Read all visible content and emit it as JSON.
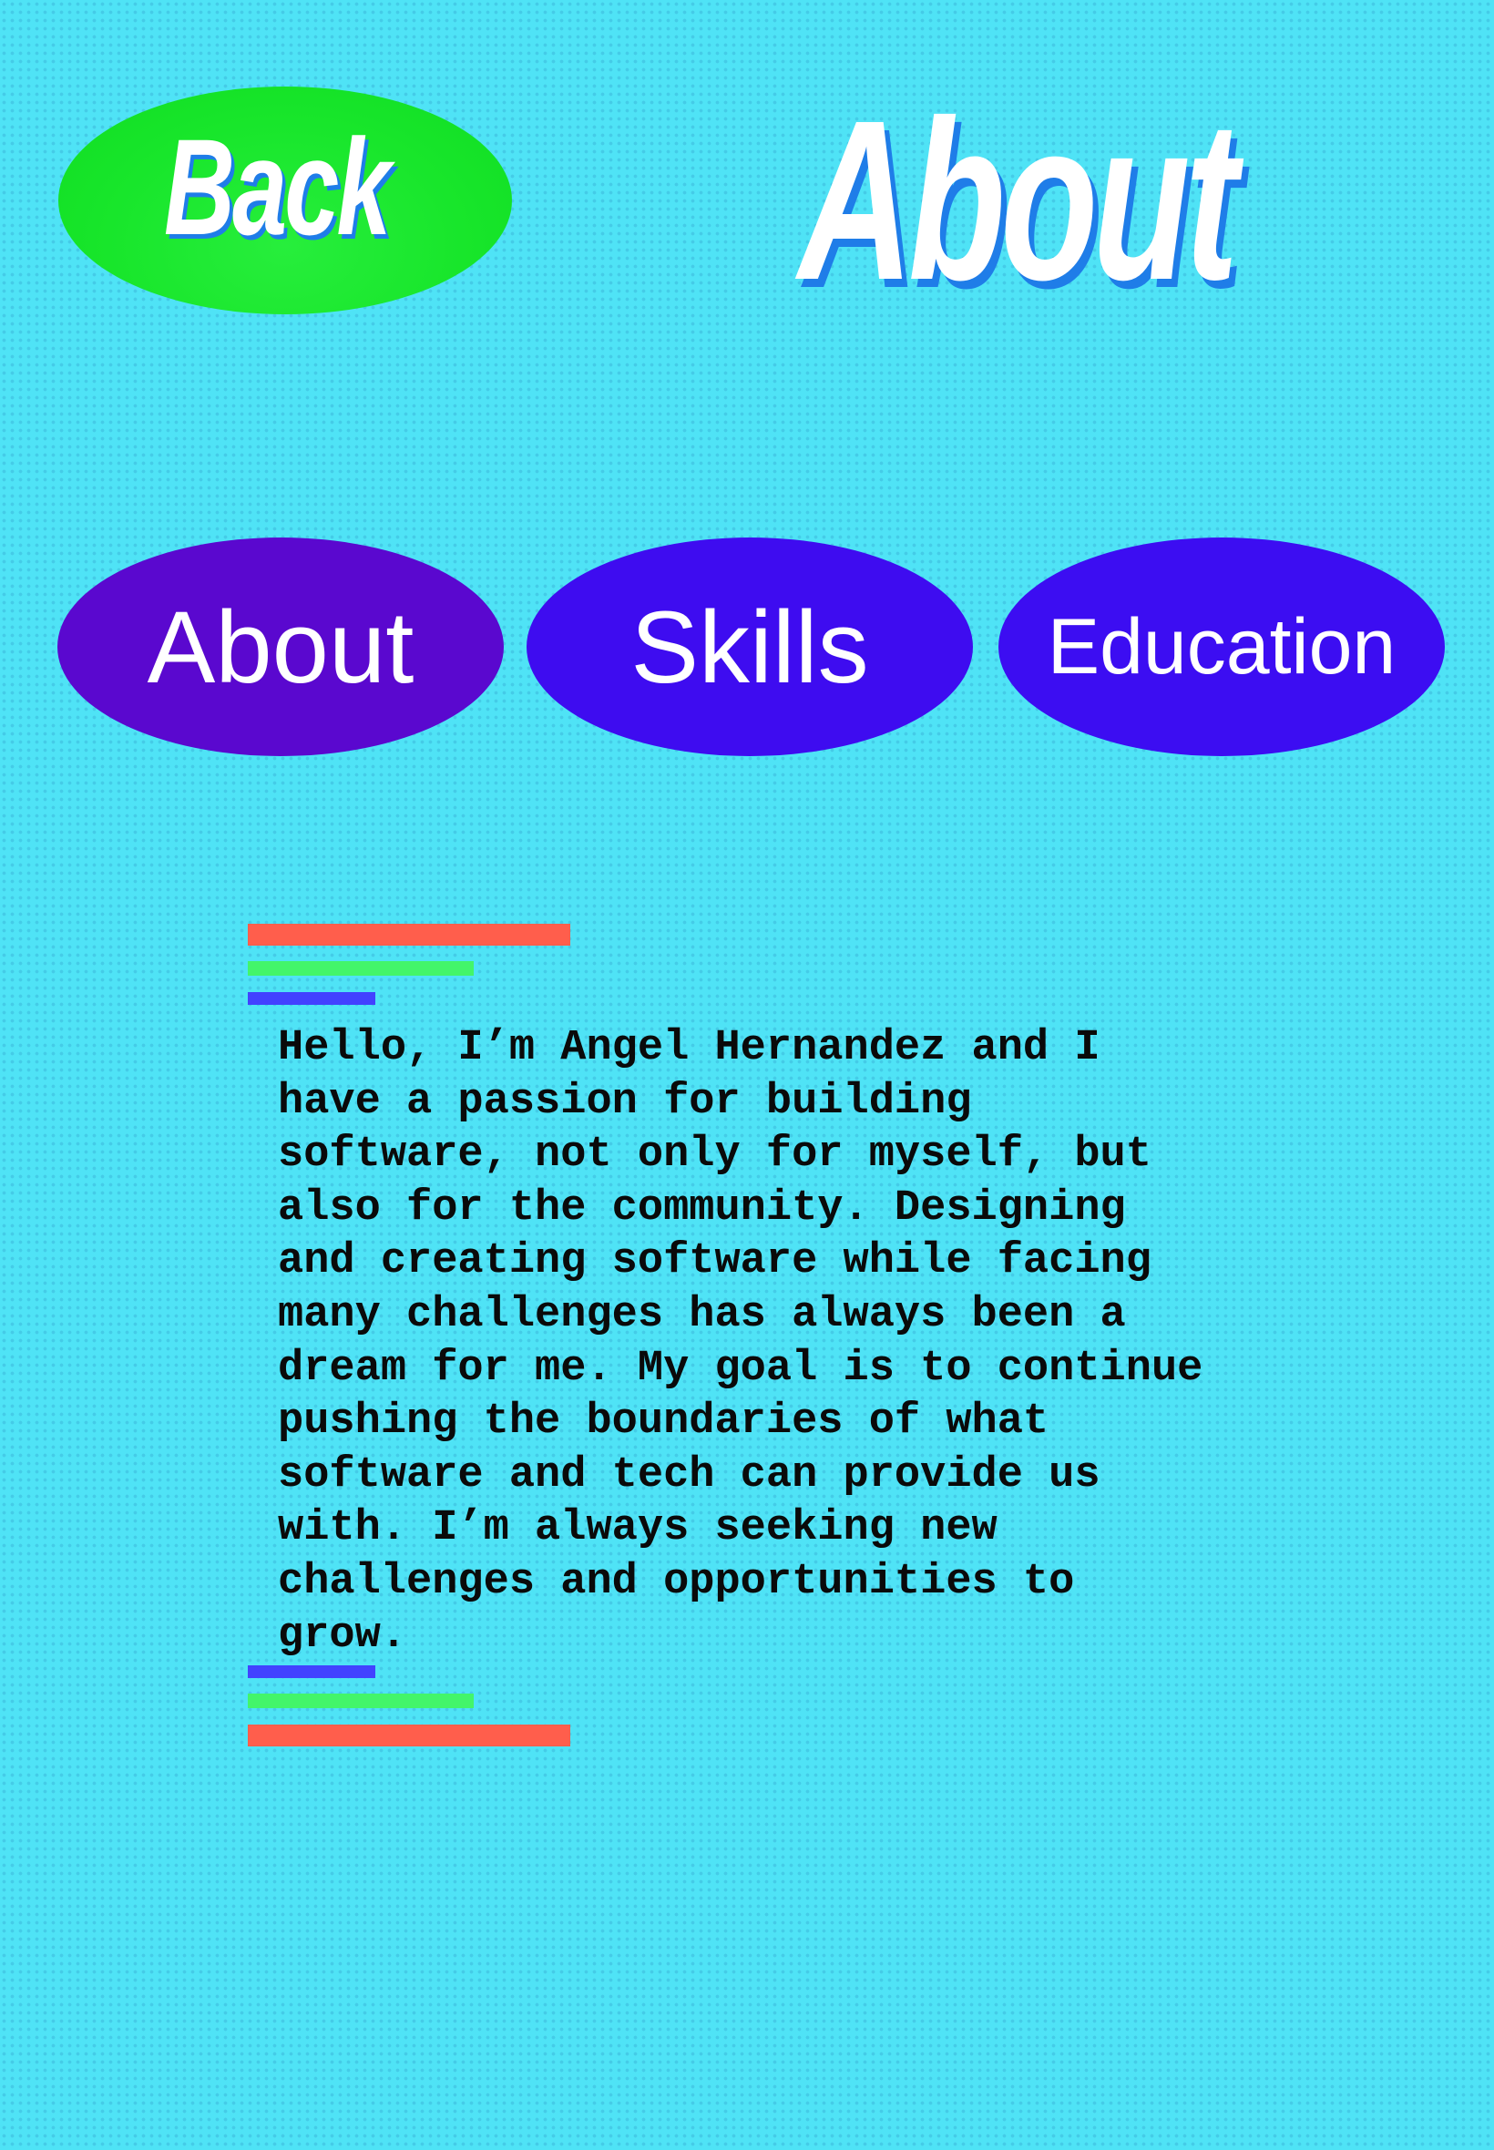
{
  "header": {
    "back_label": "Back",
    "title": "About"
  },
  "nav": {
    "tabs": [
      {
        "label": "About",
        "color": "#5a08cf"
      },
      {
        "label": "Skills",
        "color": "#3e0cf0"
      },
      {
        "label": "Education",
        "color": "#3c0df2"
      }
    ]
  },
  "bio": {
    "text": "Hello, I’m Angel Hernandez and I\nhave a passion for building\nsoftware, not only for myself, but\nalso for the community. Designing\nand creating software while facing\nmany challenges has always been a\ndream for me. My goal is to continue\npushing the boundaries of what\nsoftware and tech can provide us\nwith. I’m always seeking new\nchallenges and opportunities to\ngrow."
  },
  "colors": {
    "background": "#4fe3f6",
    "back_button": "#18e62b",
    "title_shadow": "#1f7de8",
    "bar_red": "#ff5e4c",
    "bar_green": "#43f56a",
    "bar_blue": "#4242ff"
  }
}
